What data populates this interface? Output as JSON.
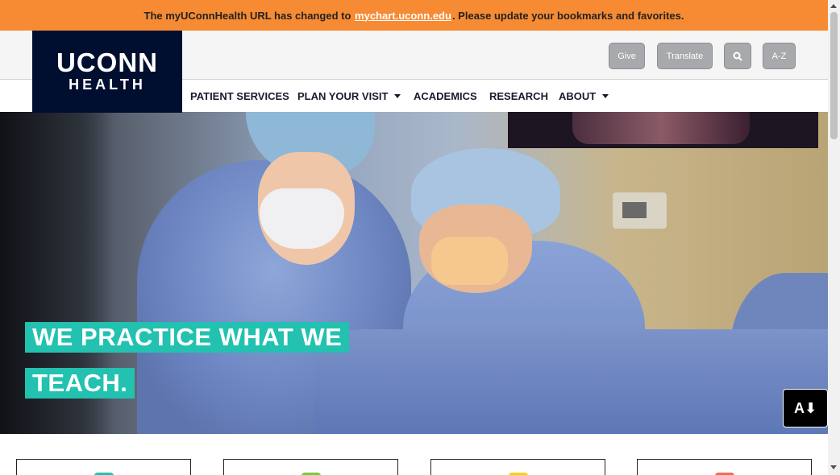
{
  "banner": {
    "text_before": "The myUConnHealth URL has changed to",
    "link": "mychart.uconn.edu",
    "text_after": ". Please update your bookmarks and favorites."
  },
  "logo": {
    "line1": "UCONN",
    "line2": "HEALTH"
  },
  "utility": {
    "give": "Give",
    "translate": "Translate",
    "search_icon": "🔍",
    "az": "A-Z"
  },
  "nav": {
    "items": [
      {
        "label": "PATIENT SERVICES"
      },
      {
        "label": "PLAN YOUR VISIT"
      },
      {
        "label": "ACADEMICS"
      },
      {
        "label": "RESEARCH"
      },
      {
        "label": "ABOUT"
      }
    ]
  },
  "hero": {
    "line1": "WE PRACTICE WHAT WE",
    "line2": "TEACH."
  },
  "accessibility": {
    "icon": "A⬇"
  },
  "cards": {
    "colors": [
      "#22c1b0",
      "#7ac943",
      "#f5d400",
      "#f26d4f"
    ]
  },
  "colors": {
    "banner": "#f68b33",
    "logo_bg": "#000e2f",
    "accent": "#22c1b0",
    "util_btn": "#a7a9ac"
  }
}
